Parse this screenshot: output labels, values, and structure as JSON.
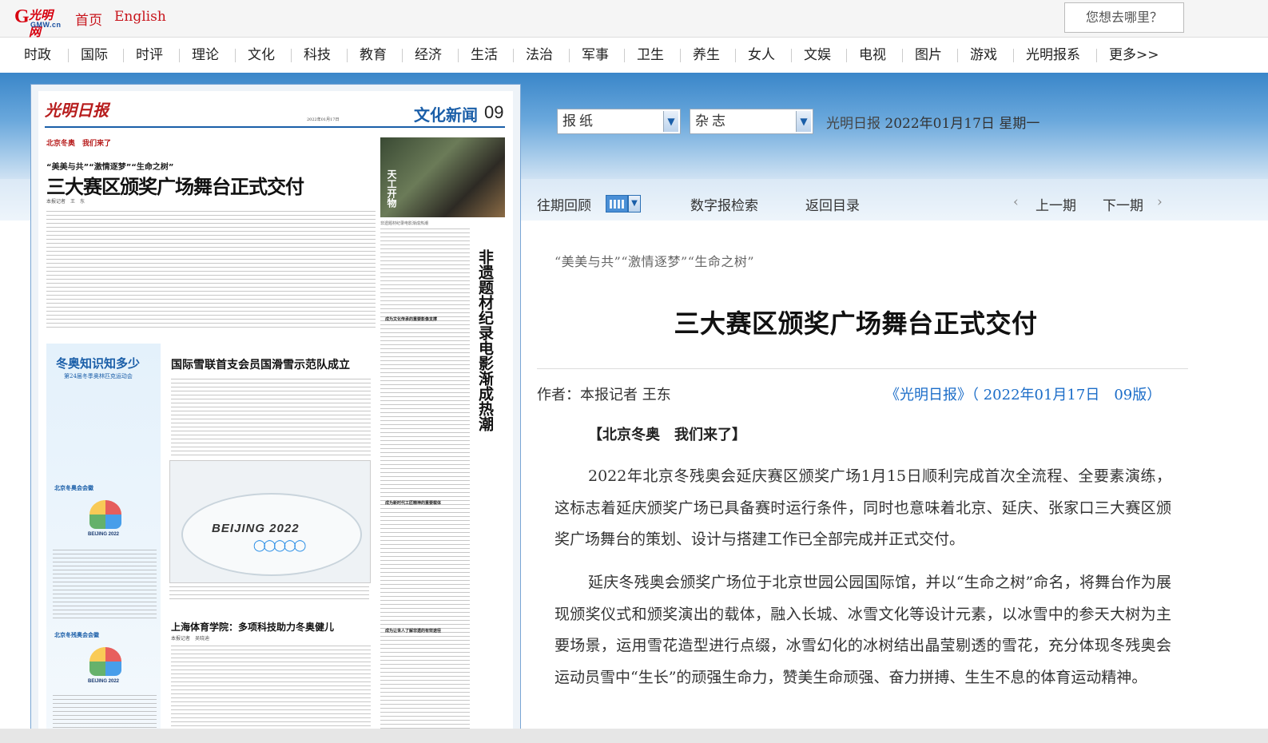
{
  "topbar": {
    "logo_cn": "光明网",
    "logo_en": "GMW.cn",
    "home": "首页",
    "english": "English",
    "search_placeholder": "您想去哪里？"
  },
  "nav": [
    "时政",
    "国际",
    "时评",
    "理论",
    "文化",
    "科技",
    "教育",
    "经济",
    "生活",
    "法治",
    "军事",
    "卫生",
    "养生",
    "女人",
    "文娱",
    "电视",
    "图片",
    "游戏",
    "光明报系",
    "更多>>"
  ],
  "selectors": {
    "newspaper": "报纸",
    "magazine": "杂志",
    "paper_name": "光明日报",
    "date": "2022年01月17日",
    "weekday": "星期一"
  },
  "toolbar": {
    "archive": "往期回顾",
    "digital_search": "数字报检索",
    "back_to_toc": "返回目录",
    "prev": "上一期",
    "next": "下一期"
  },
  "page_image": {
    "masthead": "光明日报",
    "section": "文化新闻",
    "page_no": "09",
    "kicker": "北京冬奥　我们来了",
    "subhead": "“美美与共”“激情逐梦”“生命之树”",
    "headline": "三大赛区颁奖广场舞台正式交付",
    "byline": "本报记者　王　东",
    "photo_label": "天工开物",
    "vertical_headline": "非遗题材纪录电影渐成热潮",
    "sidebar_title": "冬奥知识知多少",
    "sidebar_subtitle": "第24届冬季奥林匹克运动会",
    "sidebar_label1": "北京冬奥会会徽",
    "sidebar_label2": "北京冬残奥会会徽",
    "emblem_text": "BEIJING 2022",
    "head2": "国际雪联首支会员国滑雪示范队成立",
    "rink_text": "BEIJING 2022",
    "head3": "上海体育学院：多项科技助力冬奥健儿",
    "byline3": "本报记者　吴晓迪",
    "section_a": "成为文化传承的重要影像支撑",
    "section_b": "成为新时代工匠精神的重要载体",
    "section_c": "成为让世人了解非遗的有效途径"
  },
  "article": {
    "subtitle": "“美美与共”“激情逐梦”“生命之树”",
    "headline": "三大赛区颁奖广场舞台正式交付",
    "author_label": "作者：",
    "author": "本报记者 王东",
    "source": "《光明日报》（ 2022年01月17日　09版）",
    "kicker": "【北京冬奥　我们来了】",
    "paragraphs": [
      "2022年北京冬残奥会延庆赛区颁奖广场1月15日顺利完成首次全流程、全要素演练，这标志着延庆颁奖广场已具备赛时运行条件，同时也意味着北京、延庆、张家口三大赛区颁奖广场舞台的策划、设计与搭建工作已全部完成并正式交付。",
      "延庆冬残奥会颁奖广场位于北京世园公园国际馆，并以“生命之树”命名，将舞台作为展现颁奖仪式和颁奖演出的载体，融入长城、冰雪文化等设计元素，以冰雪中的参天大树为主要场景，运用雪花造型进行点缀，冰雪幻化的冰树结出晶莹剔透的雪花，充分体现冬残奥会运动员雪中“生长”的顽强生命力，赞美生命顽强、奋力拼搏、生生不息的体育运动精神。"
    ]
  },
  "colors": {
    "brand_red": "#c8161d",
    "link_blue": "#1a6cc8",
    "band_blue": "#3a86c9"
  }
}
